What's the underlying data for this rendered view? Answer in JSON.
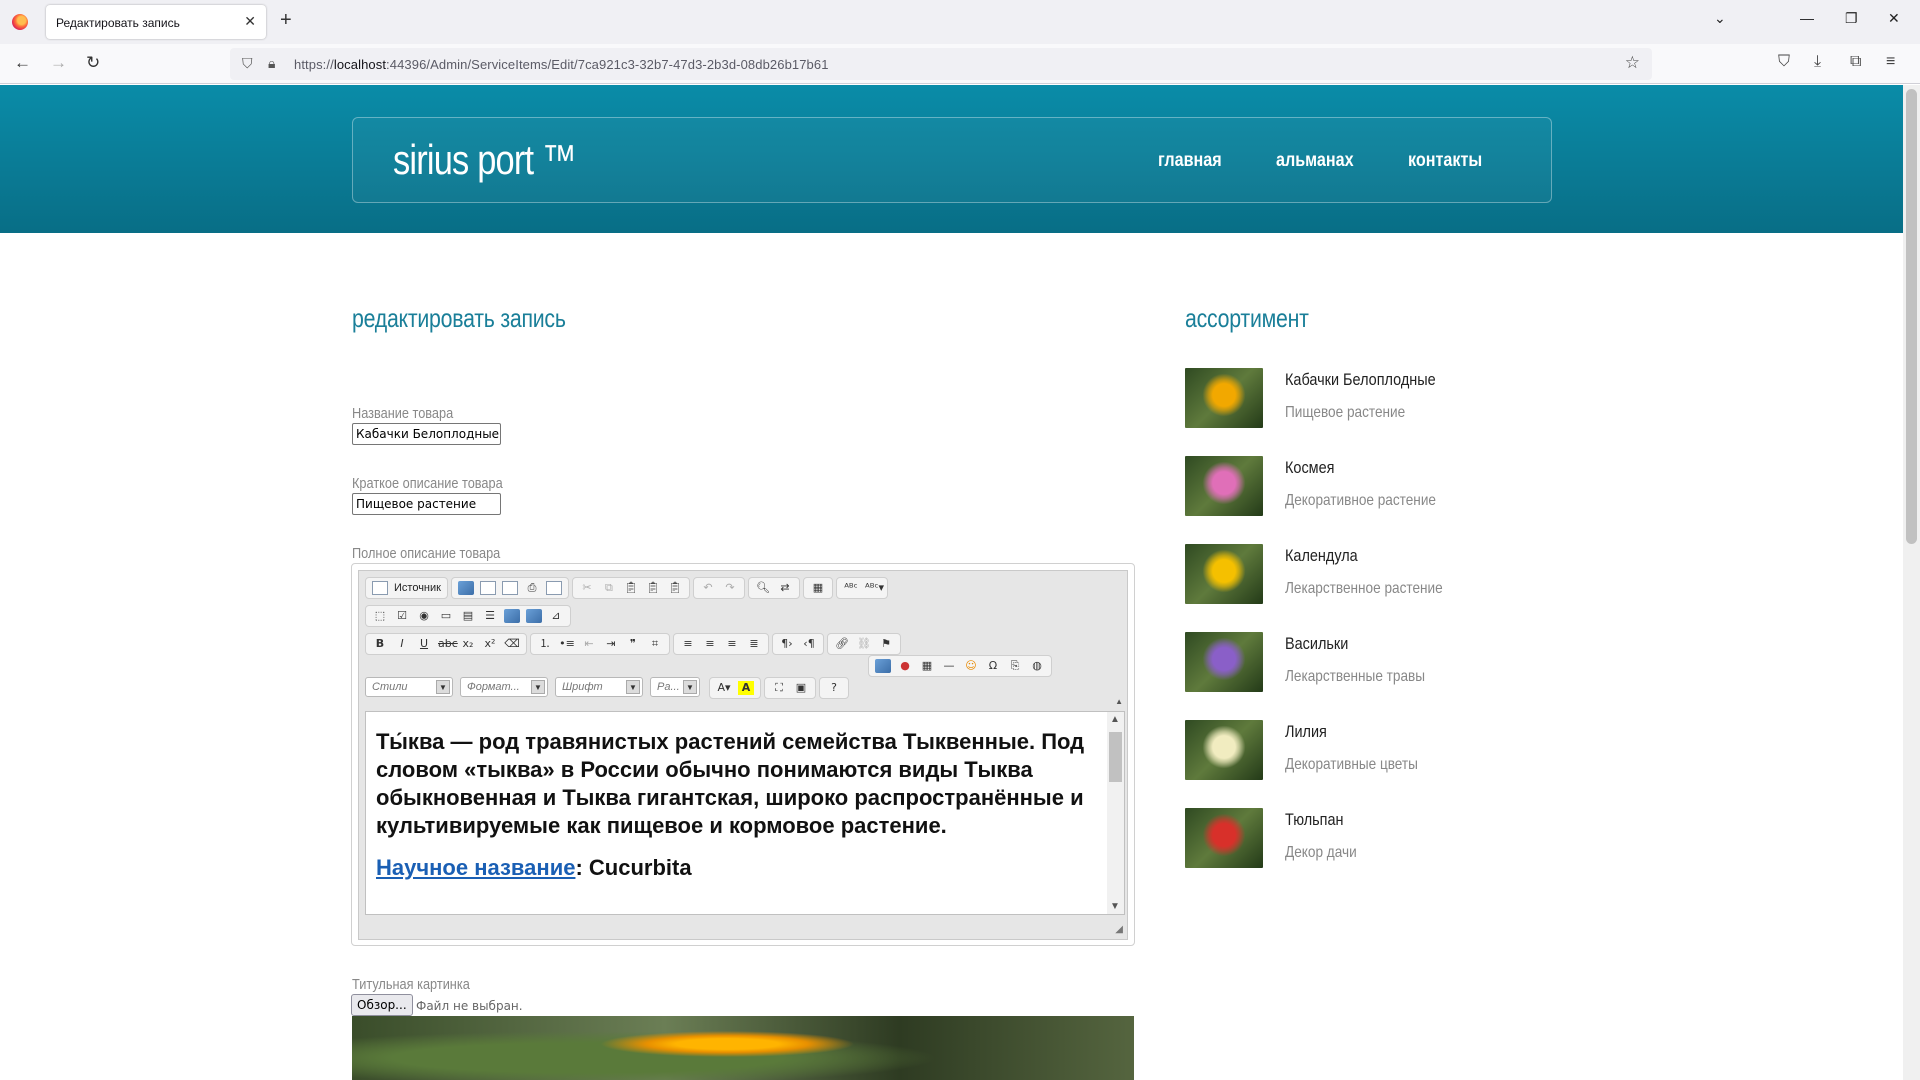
{
  "browser": {
    "tab_title": "Редактировать запись",
    "tab_close": "✕",
    "new_tab": "+",
    "url_prefix": "https://",
    "url_host": "localhost",
    "url_rest": ":44396/Admin/ServiceItems/Edit/7ca921c3-32b7-47d3-2b3d-08db26b17b61"
  },
  "header": {
    "logo": "sirius port ™",
    "menu": [
      "главная",
      "альманах",
      "контакты"
    ]
  },
  "form": {
    "title": "редактировать запись",
    "name_label": "Название товара",
    "name_value": "Кабачки Белоплодные",
    "short_label": "Краткое описание товара",
    "short_value": "Пищевое растение",
    "full_label": "Полное описание товара",
    "editor": {
      "source_label": "Источник",
      "styles": "Стили",
      "format": "Формат...",
      "font": "Шрифт",
      "size": "Ра...",
      "paragraph1": "Ты́ква — род травянистых растений семейства Тыквенные. Под словом «тыква» в России обычно понимаются виды Тыква обыкновенная и Тыква гигантская, широко распространённые и культивируемые как пищевое и кормовое растение.",
      "sci_link": "Научное название",
      "sci_value": ": Cucurbita"
    },
    "image_label": "Титульная картинка",
    "browse_button": "Обзор...",
    "file_status": "Файл не выбран."
  },
  "sidebar": {
    "title": "ассортимент",
    "items": [
      {
        "name": "Кабачки Белоплодные",
        "desc": "Пищевое растение",
        "color": "#f2a800"
      },
      {
        "name": "Космея",
        "desc": "Декоративное растение",
        "color": "#e06fb8"
      },
      {
        "name": "Календула",
        "desc": "Лекарственное растение",
        "color": "#f5c000"
      },
      {
        "name": "Васильки",
        "desc": "Лекарственные травы",
        "color": "#8a5fc8"
      },
      {
        "name": "Лилия",
        "desc": "Декоративные цветы",
        "color": "#f1ecc0"
      },
      {
        "name": "Тюльпан",
        "desc": "Декор дачи",
        "color": "#d8302a"
      }
    ]
  }
}
